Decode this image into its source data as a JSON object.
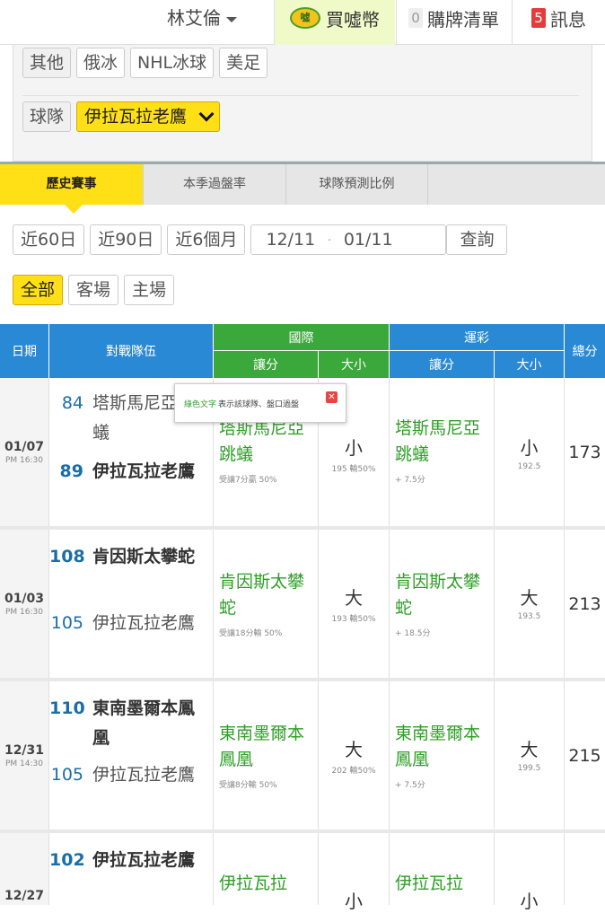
{
  "topbar": {
    "user_name": "林艾倫",
    "buy_label": "買噓幣",
    "coin_text": "噓",
    "cart_count": "0",
    "cart_label": "購牌清單",
    "msg_count": "5",
    "msg_label": "訊息"
  },
  "filter": {
    "other_label": "其他",
    "leagues": [
      "俄冰",
      "NHL冰球",
      "美足"
    ],
    "team_label": "球隊",
    "team_selected": "伊拉瓦拉老鷹"
  },
  "tabs": [
    "歷史賽事",
    "本季過盤率",
    "球隊預測比例"
  ],
  "range_buttons": [
    "近60日",
    "近90日",
    "近6個月"
  ],
  "date_from": "12/11",
  "date_sep": "-",
  "date_to": "01/11",
  "search_label": "查詢",
  "venue": [
    "全部",
    "客場",
    "主場"
  ],
  "table_header": {
    "date": "日期",
    "teams": "對戰隊伍",
    "intl": "國際",
    "lottery": "運彩",
    "spread": "讓分",
    "ou": "大小",
    "total": "總分"
  },
  "tooltip": {
    "green_text": "綠色文字",
    "rest": "表示該球隊、盤口過盤"
  },
  "colors": {
    "header_blue": "#2a89d4",
    "header_green": "#3aa83a",
    "accent_yellow": "#ffe016",
    "win_green": "#2e9e26"
  },
  "rows": [
    {
      "date": "01/07",
      "time": "PM 16:30",
      "away_score": "84",
      "away_name": "塔斯馬尼亞跳蟻",
      "home_score": "89",
      "home_name": "伊拉瓦拉老鷹",
      "intl_spread_team": "塔斯馬尼亞跳蟻",
      "intl_spread_note": "受讓7分贏 50%",
      "intl_ou": "小",
      "intl_ou_note": "195 輸50%",
      "lot_spread_team": "塔斯馬尼亞跳蟻",
      "lot_spread_note": "+ 7.5分",
      "lot_ou": "小",
      "lot_ou_note": "192.5",
      "total": "173"
    },
    {
      "date": "01/03",
      "time": "PM 16:30",
      "away_score": "108",
      "away_name": "肯因斯太攀蛇",
      "home_score": "105",
      "home_name": "伊拉瓦拉老鷹",
      "intl_spread_team": "肯因斯太攀蛇",
      "intl_spread_note": "受讓18分輸 50%",
      "intl_ou": "大",
      "intl_ou_note": "193 輸50%",
      "lot_spread_team": "肯因斯太攀蛇",
      "lot_spread_note": "+ 18.5分",
      "lot_ou": "大",
      "lot_ou_note": "193.5",
      "total": "213"
    },
    {
      "date": "12/31",
      "time": "PM 14:30",
      "away_score": "110",
      "away_name": "東南墨爾本鳳凰",
      "home_score": "105",
      "home_name": "伊拉瓦拉老鷹",
      "intl_spread_team": "東南墨爾本鳳凰",
      "intl_spread_note": "受讓8分輸 50%",
      "intl_ou": "大",
      "intl_ou_note": "202 輸50%",
      "lot_spread_team": "東南墨爾本鳳凰",
      "lot_spread_note": "+ 7.5分",
      "lot_ou": "大",
      "lot_ou_note": "199.5",
      "total": "215"
    },
    {
      "date": "12/27",
      "time": "",
      "away_score": "102",
      "away_name": "伊拉瓦拉老鷹",
      "home_score": "",
      "home_name": "",
      "intl_spread_team": "伊拉瓦拉",
      "intl_spread_note": "",
      "intl_ou": "小",
      "intl_ou_note": "",
      "lot_spread_team": "伊拉瓦拉",
      "lot_spread_note": "",
      "lot_ou": "小",
      "lot_ou_note": "",
      "total": ""
    }
  ]
}
